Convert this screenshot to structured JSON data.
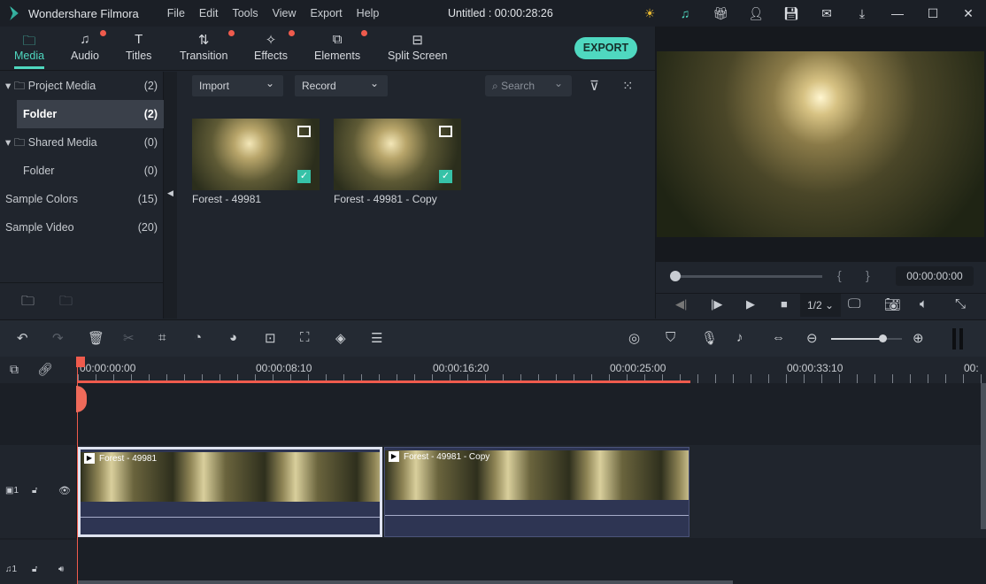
{
  "app": {
    "name": "Wondershare Filmora",
    "doc_title": "Untitled : 00:00:28:26",
    "menu": [
      "File",
      "Edit",
      "Tools",
      "View",
      "Export",
      "Help"
    ]
  },
  "tabs": [
    {
      "label": "Media",
      "active": true
    },
    {
      "label": "Audio",
      "dot": true
    },
    {
      "label": "Titles"
    },
    {
      "label": "Transition",
      "dot": true
    },
    {
      "label": "Effects",
      "dot": true
    },
    {
      "label": "Elements",
      "dot": true
    },
    {
      "label": "Split Screen"
    }
  ],
  "export_label": "EXPORT",
  "library": [
    {
      "label": "Project Media",
      "count": "(2)"
    },
    {
      "label": "Folder",
      "count": "(2)"
    },
    {
      "label": "Shared Media",
      "count": "(0)"
    },
    {
      "label": "Folder",
      "count": "(0)"
    },
    {
      "label": "Sample Colors",
      "count": "(15)"
    },
    {
      "label": "Sample Video",
      "count": "(20)"
    }
  ],
  "media_toolbar": {
    "import": "Import",
    "record": "Record",
    "search_placeholder": "Search"
  },
  "media_items": [
    {
      "name": "Forest - 49981"
    },
    {
      "name": "Forest - 49981 - Copy"
    }
  ],
  "preview": {
    "timecode": "00:00:00:00",
    "quality": "1/2",
    "progress": 0
  },
  "timeline": {
    "ticks": [
      "00:00:00:00",
      "00:00:08:10",
      "00:00:16:20",
      "00:00:25:00",
      "00:00:33:10",
      "00:"
    ],
    "zoom": 0.72,
    "clips": [
      {
        "name": "Forest - 49981"
      },
      {
        "name": "Forest - 49981 - Copy"
      }
    ],
    "video_track": "1",
    "audio_track": "1"
  },
  "colors": {
    "accent": "#4fd8c0",
    "playhead": "#ef5b4d"
  }
}
